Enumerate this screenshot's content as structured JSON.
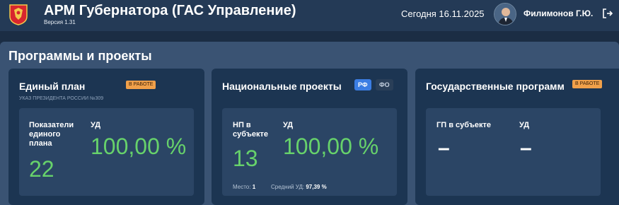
{
  "header": {
    "title": "АРМ Губернатора (ГАС Управление)",
    "version": "Версия 1.31",
    "today": "Сегодня 16.11.2025",
    "user_name": "Филимонов Г.Ю.",
    "logo_icon": "coat-of-arms-icon",
    "logout_icon": "logout-icon"
  },
  "section": {
    "title": "Программы и проекты"
  },
  "cards": {
    "single_plan": {
      "title": "Единый план",
      "badge": "В РАБОТЕ",
      "subtitle": "УКАЗ ПРЕЗИДЕНТА РОССИИ №309",
      "metric1_label": "Показатели единого плана",
      "metric1_value": "22",
      "metric2_label": "УД",
      "metric2_value": "100,00 %"
    },
    "national_projects": {
      "title": "Национальные проекты",
      "tab_rf": "РФ",
      "tab_fo": "ФО",
      "metric1_label": "НП в субъекте",
      "metric1_value": "13",
      "metric2_label": "УД",
      "metric2_value": "100,00 %",
      "place_label": "Место:",
      "place_value": "1",
      "avg_label": "Средний УД:",
      "avg_value": "97,39 %"
    },
    "state_programs": {
      "title": "Государственные программ",
      "badge": "В РАБОТЕ",
      "metric1_label": "ГП в субъекте",
      "metric1_value": "–",
      "metric2_label": "УД",
      "metric2_value": "–"
    }
  },
  "colors": {
    "background": "#1b2d44",
    "topbar": "#243a56",
    "section": "#3a5373",
    "card": "#1c3552",
    "inner": "#2b4565",
    "accent_green": "#67d26b",
    "badge_orange": "#f0a04a",
    "tab_blue": "#3b7de3"
  }
}
